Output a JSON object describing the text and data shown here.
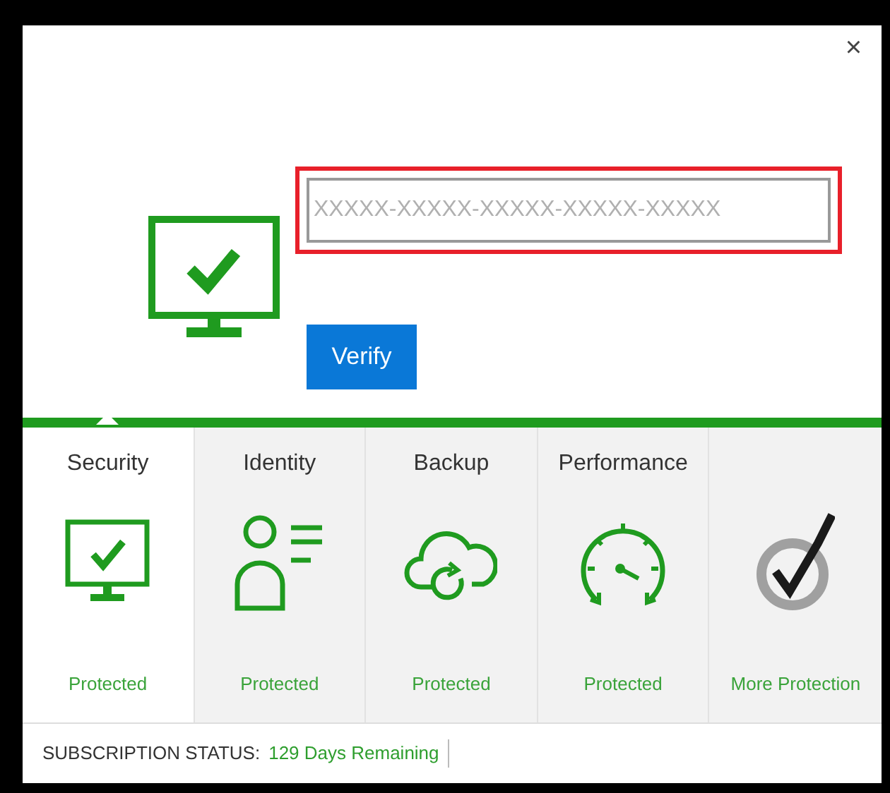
{
  "window": {
    "close": "×"
  },
  "activation": {
    "key_field": {
      "placeholder": "XXXXX-XXXXX-XXXXX-XXXXX-XXXXX",
      "highlighted": true
    },
    "verify_button": "Verify"
  },
  "tiles": [
    {
      "title": "Security",
      "status": "Protected",
      "kind": "monitor",
      "selected": true
    },
    {
      "title": "Identity",
      "status": "Protected",
      "kind": "person",
      "selected": false
    },
    {
      "title": "Backup",
      "status": "Protected",
      "kind": "cloud",
      "selected": false
    },
    {
      "title": "Performance",
      "status": "Protected",
      "kind": "gauge",
      "selected": false
    },
    {
      "status": "More Protection",
      "kind": "badge",
      "selected": false
    }
  ],
  "status_bar": {
    "label": "SUBSCRIPTION STATUS:",
    "value": "129 Days Remaining"
  }
}
